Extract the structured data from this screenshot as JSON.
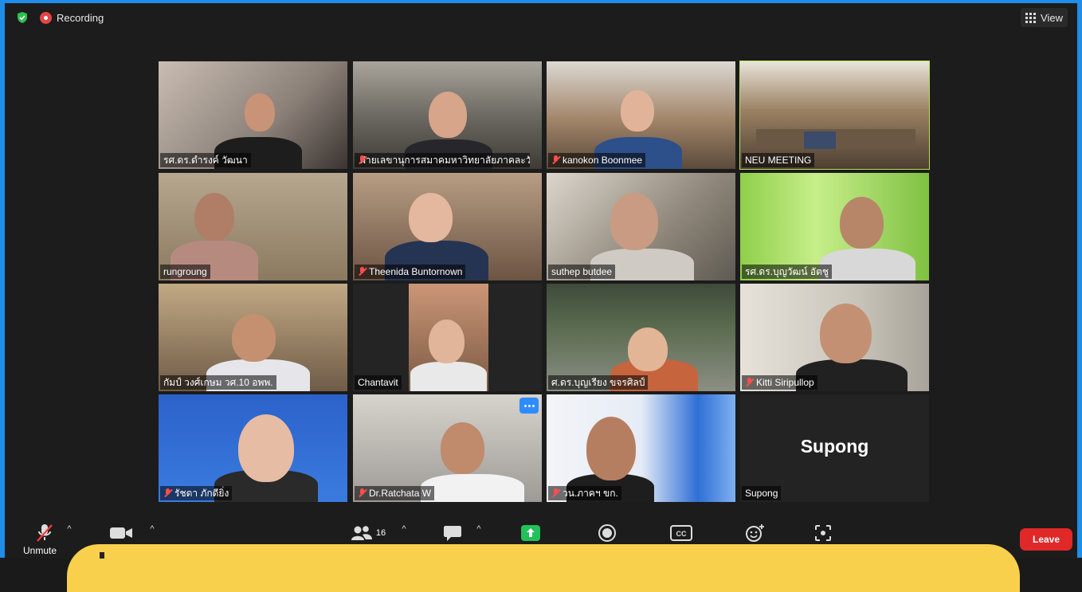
{
  "topbar": {
    "recording_label": "Recording",
    "view_label": "View"
  },
  "participants": [
    {
      "name": "รศ.ดร.ดำรงค์ วัฒนา",
      "muted": false,
      "active": false
    },
    {
      "name": "ฝ่ายเลขานุการสมาคมหาวิทยาลัยภาคละวั...",
      "muted": true,
      "active": false
    },
    {
      "name": "kanokon Boonmee",
      "muted": true,
      "active": false
    },
    {
      "name": "NEU MEETING",
      "muted": false,
      "active": true
    },
    {
      "name": "rungroung",
      "muted": false,
      "active": false
    },
    {
      "name": "Theenida Buntornown",
      "muted": true,
      "active": false
    },
    {
      "name": "suthep butdee",
      "muted": false,
      "active": false
    },
    {
      "name": "รศ.ดร.บุญวัฒน์ อัตชู",
      "muted": false,
      "active": false
    },
    {
      "name": "กัมป์ วงศ์เกษม วศ.10 อพพ.",
      "muted": false,
      "active": false
    },
    {
      "name": "Chantavit",
      "muted": false,
      "active": false
    },
    {
      "name": "ศ.ดร.บุญเรียง ขจรศิลป์",
      "muted": false,
      "active": false
    },
    {
      "name": "Kitti Siripullop",
      "muted": true,
      "active": false
    },
    {
      "name": "รัชดา ภักดียิ่ง",
      "muted": true,
      "active": false
    },
    {
      "name": "Dr.Ratchata W",
      "muted": true,
      "active": false
    },
    {
      "name": "วน.ภาคฯ ขก.",
      "muted": true,
      "active": false
    },
    {
      "name": "Supong",
      "muted": false,
      "active": false,
      "display_name": "Supong"
    }
  ],
  "toolbar": {
    "unmute_label": "Unmute",
    "participants_count": "16",
    "leave_label": "Leave",
    "cc_label": "CC"
  }
}
